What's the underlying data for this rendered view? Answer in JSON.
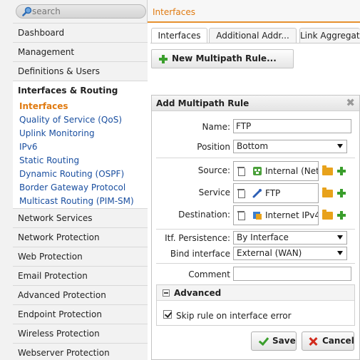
{
  "search": {
    "placeholder": "search",
    "icon": "search-icon"
  },
  "sidebar": {
    "items": [
      {
        "label": "Dashboard"
      },
      {
        "label": "Management"
      },
      {
        "label": "Definitions & Users"
      },
      {
        "label": "Interfaces & Routing"
      },
      {
        "label": "Network Services"
      },
      {
        "label": "Network Protection"
      },
      {
        "label": "Web Protection"
      },
      {
        "label": "Email Protection"
      },
      {
        "label": "Advanced Protection"
      },
      {
        "label": "Endpoint Protection"
      },
      {
        "label": "Wireless Protection"
      },
      {
        "label": "Webserver Protection"
      }
    ],
    "sub_items": [
      {
        "label": "Interfaces",
        "selected": true
      },
      {
        "label": "Quality of Service (QoS)"
      },
      {
        "label": "Uplink Monitoring"
      },
      {
        "label": "IPv6"
      },
      {
        "label": "Static Routing"
      },
      {
        "label": "Dynamic Routing (OSPF)"
      },
      {
        "label": "Border Gateway Protocol"
      },
      {
        "label": "Multicast Routing (PIM-SM)"
      }
    ]
  },
  "header": {
    "title": "Interfaces"
  },
  "tabs": [
    {
      "label": "Interfaces",
      "active": true
    },
    {
      "label": "Additional Addr..."
    },
    {
      "label": "Link Aggregati"
    }
  ],
  "toolbar": {
    "new_rule_label": "New Multipath Rule..."
  },
  "dialog": {
    "title": "Add Multipath Rule",
    "close_glyph": "✖",
    "fields": {
      "name": {
        "label": "Name:",
        "value": "FTP"
      },
      "position": {
        "label": "Position",
        "value": "Bottom"
      },
      "source": {
        "label": "Source:",
        "value": "Internal (Netw"
      },
      "service": {
        "label": "Service",
        "value": "FTP"
      },
      "destination": {
        "label": "Destination:",
        "value": "Internet IPv4 ("
      },
      "itf_persistence": {
        "label": "Itf. Persistence:",
        "value": "By Interface"
      },
      "bind_interface": {
        "label": "Bind interface",
        "value": "External (WAN)"
      },
      "comment": {
        "label": "Comment",
        "value": ""
      }
    },
    "advanced": {
      "title": "Advanced",
      "skip_rule_label": "Skip rule on interface error",
      "skip_rule_checked": true
    },
    "buttons": {
      "save": "Save",
      "cancel": "Cancel"
    }
  },
  "colors": {
    "accent": "#e07a10",
    "link": "#1a4fa0",
    "add": "#3a9e2c",
    "folder": "#e8a21b",
    "cancel": "#d12a1c"
  }
}
